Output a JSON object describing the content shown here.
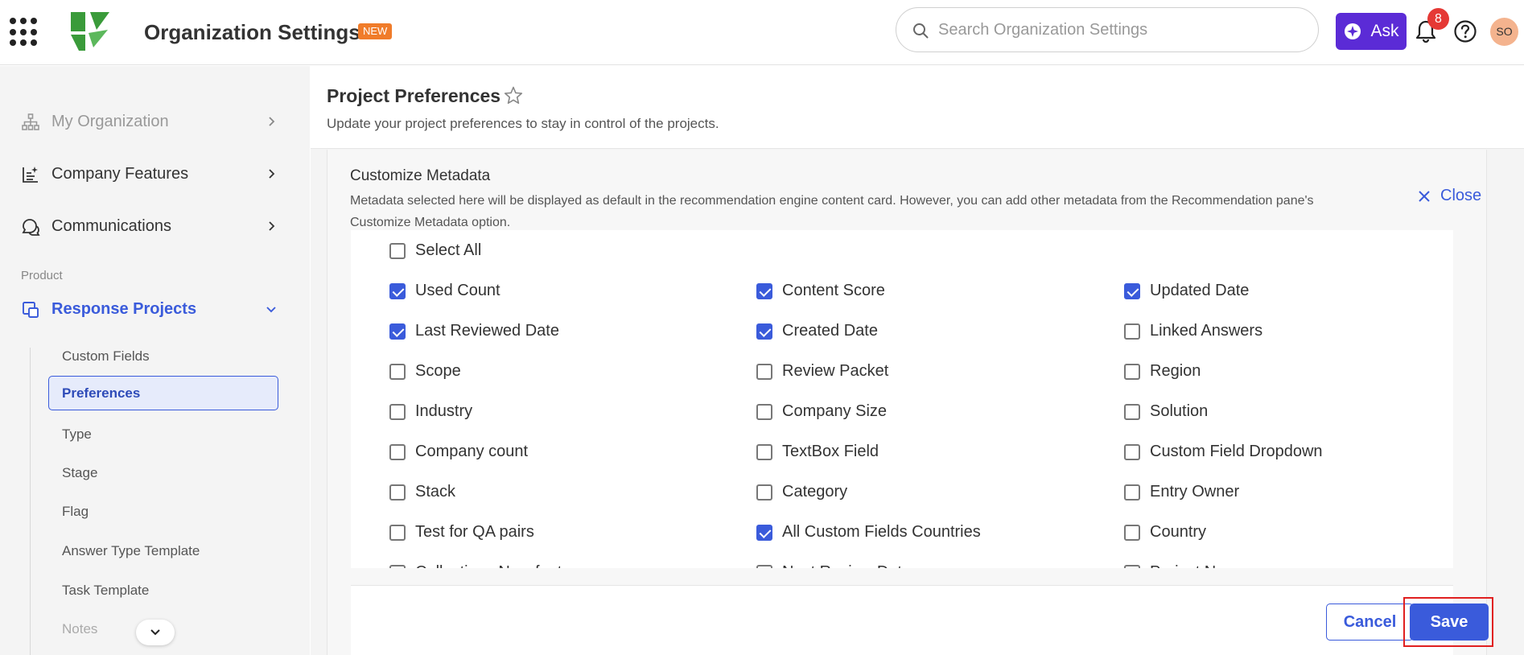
{
  "header": {
    "title": "Organization Settings",
    "new_badge": "NEW",
    "search_placeholder": "Search Organization Settings",
    "ask_label": "Ask",
    "notification_count": "8",
    "avatar_initials": "SO",
    "brand_color": "#5b2bd6",
    "logo_color": "#3a9b3a"
  },
  "sidebar": {
    "items": [
      {
        "label": "My Organization",
        "icon": "org-chart-icon"
      },
      {
        "label": "Company Features",
        "icon": "features-list-icon"
      },
      {
        "label": "Communications",
        "icon": "chat-bubbles-icon"
      }
    ],
    "section_label": "Product",
    "active_item": {
      "label": "Response Projects",
      "icon": "projects-icon"
    },
    "sub_items": [
      {
        "label": "Custom Fields"
      },
      {
        "label": "Preferences"
      },
      {
        "label": "Type"
      },
      {
        "label": "Stage"
      },
      {
        "label": "Flag"
      },
      {
        "label": "Answer Type Template"
      },
      {
        "label": "Task Template"
      },
      {
        "label": "Notes"
      }
    ],
    "selected_sub_item": "Preferences"
  },
  "main": {
    "title": "Project Preferences",
    "subtitle": "Update your project preferences to stay in control of the projects.",
    "panel": {
      "title": "Customize Metadata",
      "description": "Metadata selected here will be displayed as default in the recommendation engine content card. However, you can add other metadata from the Recommendation pane's Customize Metadata option.",
      "close_label": "Close",
      "select_all_label": "Select All",
      "select_all_checked": false,
      "options": [
        {
          "label": "Used Count",
          "checked": true
        },
        {
          "label": "Content Score",
          "checked": true
        },
        {
          "label": "Updated Date",
          "checked": true
        },
        {
          "label": "Last Reviewed Date",
          "checked": true
        },
        {
          "label": "Created Date",
          "checked": true
        },
        {
          "label": "Linked Answers",
          "checked": false
        },
        {
          "label": "Scope",
          "checked": false
        },
        {
          "label": "Review Packet",
          "checked": false
        },
        {
          "label": "Region",
          "checked": false
        },
        {
          "label": "Industry",
          "checked": false
        },
        {
          "label": "Company Size",
          "checked": false
        },
        {
          "label": "Solution",
          "checked": false
        },
        {
          "label": "Company count",
          "checked": false
        },
        {
          "label": "TextBox Field",
          "checked": false
        },
        {
          "label": "Custom Field Dropdown",
          "checked": false
        },
        {
          "label": "Stack",
          "checked": false
        },
        {
          "label": "Category",
          "checked": false
        },
        {
          "label": "Entry Owner",
          "checked": false
        },
        {
          "label": "Test for QA pairs",
          "checked": false
        },
        {
          "label": "All Custom Fields Countries",
          "checked": true
        },
        {
          "label": "Country",
          "checked": false
        },
        {
          "label": "Collections New feature",
          "checked": false
        },
        {
          "label": "Next Review Date",
          "checked": false
        },
        {
          "label": "Project Name",
          "checked": false
        }
      ],
      "cancel_label": "Cancel",
      "save_label": "Save"
    }
  },
  "accent_color": "#3a5bdb"
}
